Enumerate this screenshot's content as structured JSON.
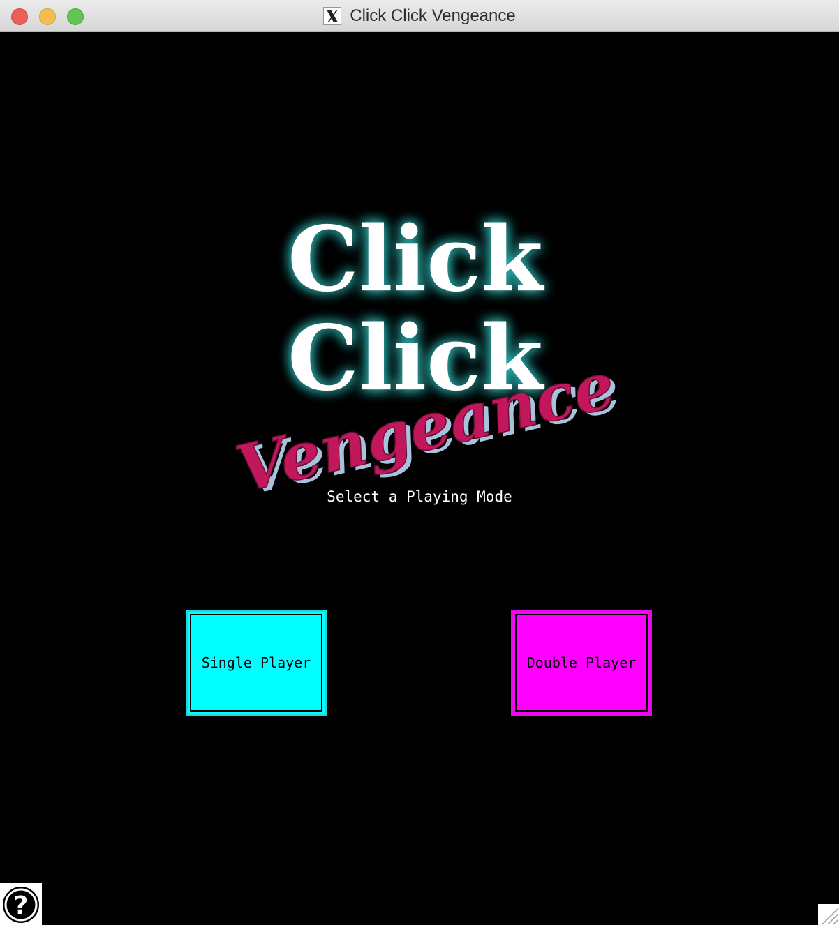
{
  "window": {
    "title": "Click Click Vengeance"
  },
  "logo": {
    "line1": "Click",
    "line2": "Click",
    "line3": "Vengeance"
  },
  "prompt": "Select a Playing Mode",
  "buttons": {
    "single": "Single Player",
    "double": "Double Player"
  },
  "colors": {
    "single_bg": "#00ffff",
    "double_bg": "#ff00ff",
    "logo_glow": "#2fb7b4",
    "vengeance": "#c2185b"
  },
  "icons": {
    "help": "question-mark-circle",
    "resize": "resize-grip"
  }
}
